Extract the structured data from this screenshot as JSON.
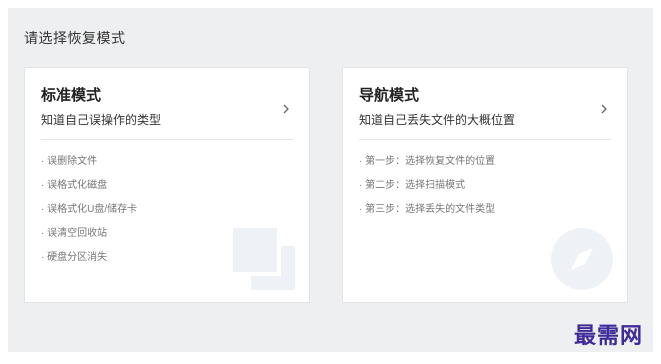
{
  "page": {
    "title": "请选择恢复模式"
  },
  "cards": [
    {
      "title": "标准模式",
      "subtitle": "知道自己误操作的类型",
      "items": [
        "· 误删除文件",
        "· 误格式化磁盘",
        "· 误格式化U盘/储存卡",
        "· 误清空回收站",
        "· 硬盘分区消失"
      ],
      "bg_icon": "overlapping-squares-icon"
    },
    {
      "title": "导航模式",
      "subtitle": "知道自己丢失文件的大概位置",
      "items": [
        "· 第一步：选择恢复文件的位置",
        "· 第二步：选择扫描模式",
        "· 第三步：选择丢失的文件类型"
      ],
      "bg_icon": "compass-icon"
    }
  ],
  "watermark": "最需网",
  "colors": {
    "panel_bg": "#eeeff1",
    "card_bg": "#ffffff",
    "icon_fill": "#eef2f7",
    "watermark": "#3f2a9a"
  }
}
